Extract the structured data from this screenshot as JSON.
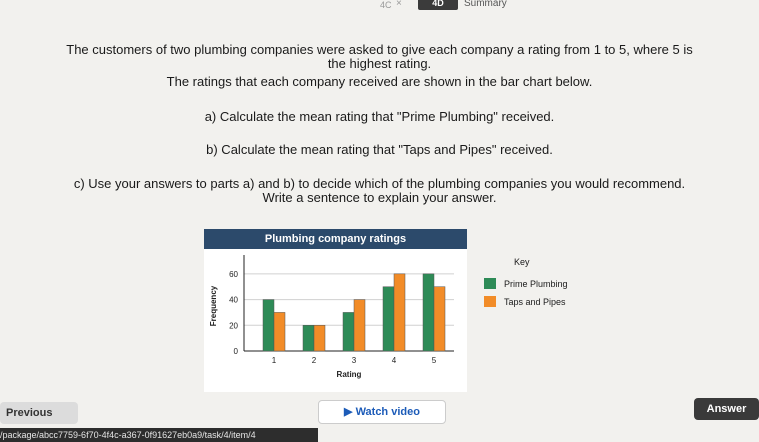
{
  "topbar": {
    "code": "4C",
    "close": "×",
    "item_id": "4D",
    "summary_label": "Summary"
  },
  "question": {
    "intro_line1": "The customers of two plumbing companies were asked to give each company a rating from 1 to 5, where 5 is",
    "intro_line2": "the highest rating.",
    "intro_line3": "The ratings that each company received are shown in the bar chart below.",
    "part_a": "a) Calculate the mean rating that \"Prime Plumbing\" received.",
    "part_b": "b) Calculate the mean rating that \"Taps and Pipes\" received.",
    "part_c": "c) Use your answers to parts a) and b) to decide which of the plumbing companies you would recommend.",
    "part_c2": "Write a sentence to explain your answer."
  },
  "chart_data": {
    "type": "bar",
    "title": "Plumbing company ratings",
    "xlabel": "Rating",
    "ylabel": "Frequency",
    "categories": [
      "1",
      "2",
      "3",
      "4",
      "5"
    ],
    "yticks": [
      "0",
      "20",
      "40",
      "60"
    ],
    "ylim": [
      0,
      70
    ],
    "grid": true,
    "series": [
      {
        "name": "Prime Plumbing",
        "color": "#2e8b57",
        "values": [
          40,
          20,
          30,
          50,
          60
        ]
      },
      {
        "name": "Taps and Pipes",
        "color": "#f28c28",
        "values": [
          30,
          20,
          40,
          60,
          50
        ]
      }
    ]
  },
  "key": {
    "title": "Key"
  },
  "buttons": {
    "previous": "Previous",
    "watch_video": "Watch video",
    "watch_icon": "▶",
    "answer": "Answer"
  },
  "url": "/package/abcc7759-6f70-4f4c-a367-0f91627eb0a9/task/4/item/4"
}
